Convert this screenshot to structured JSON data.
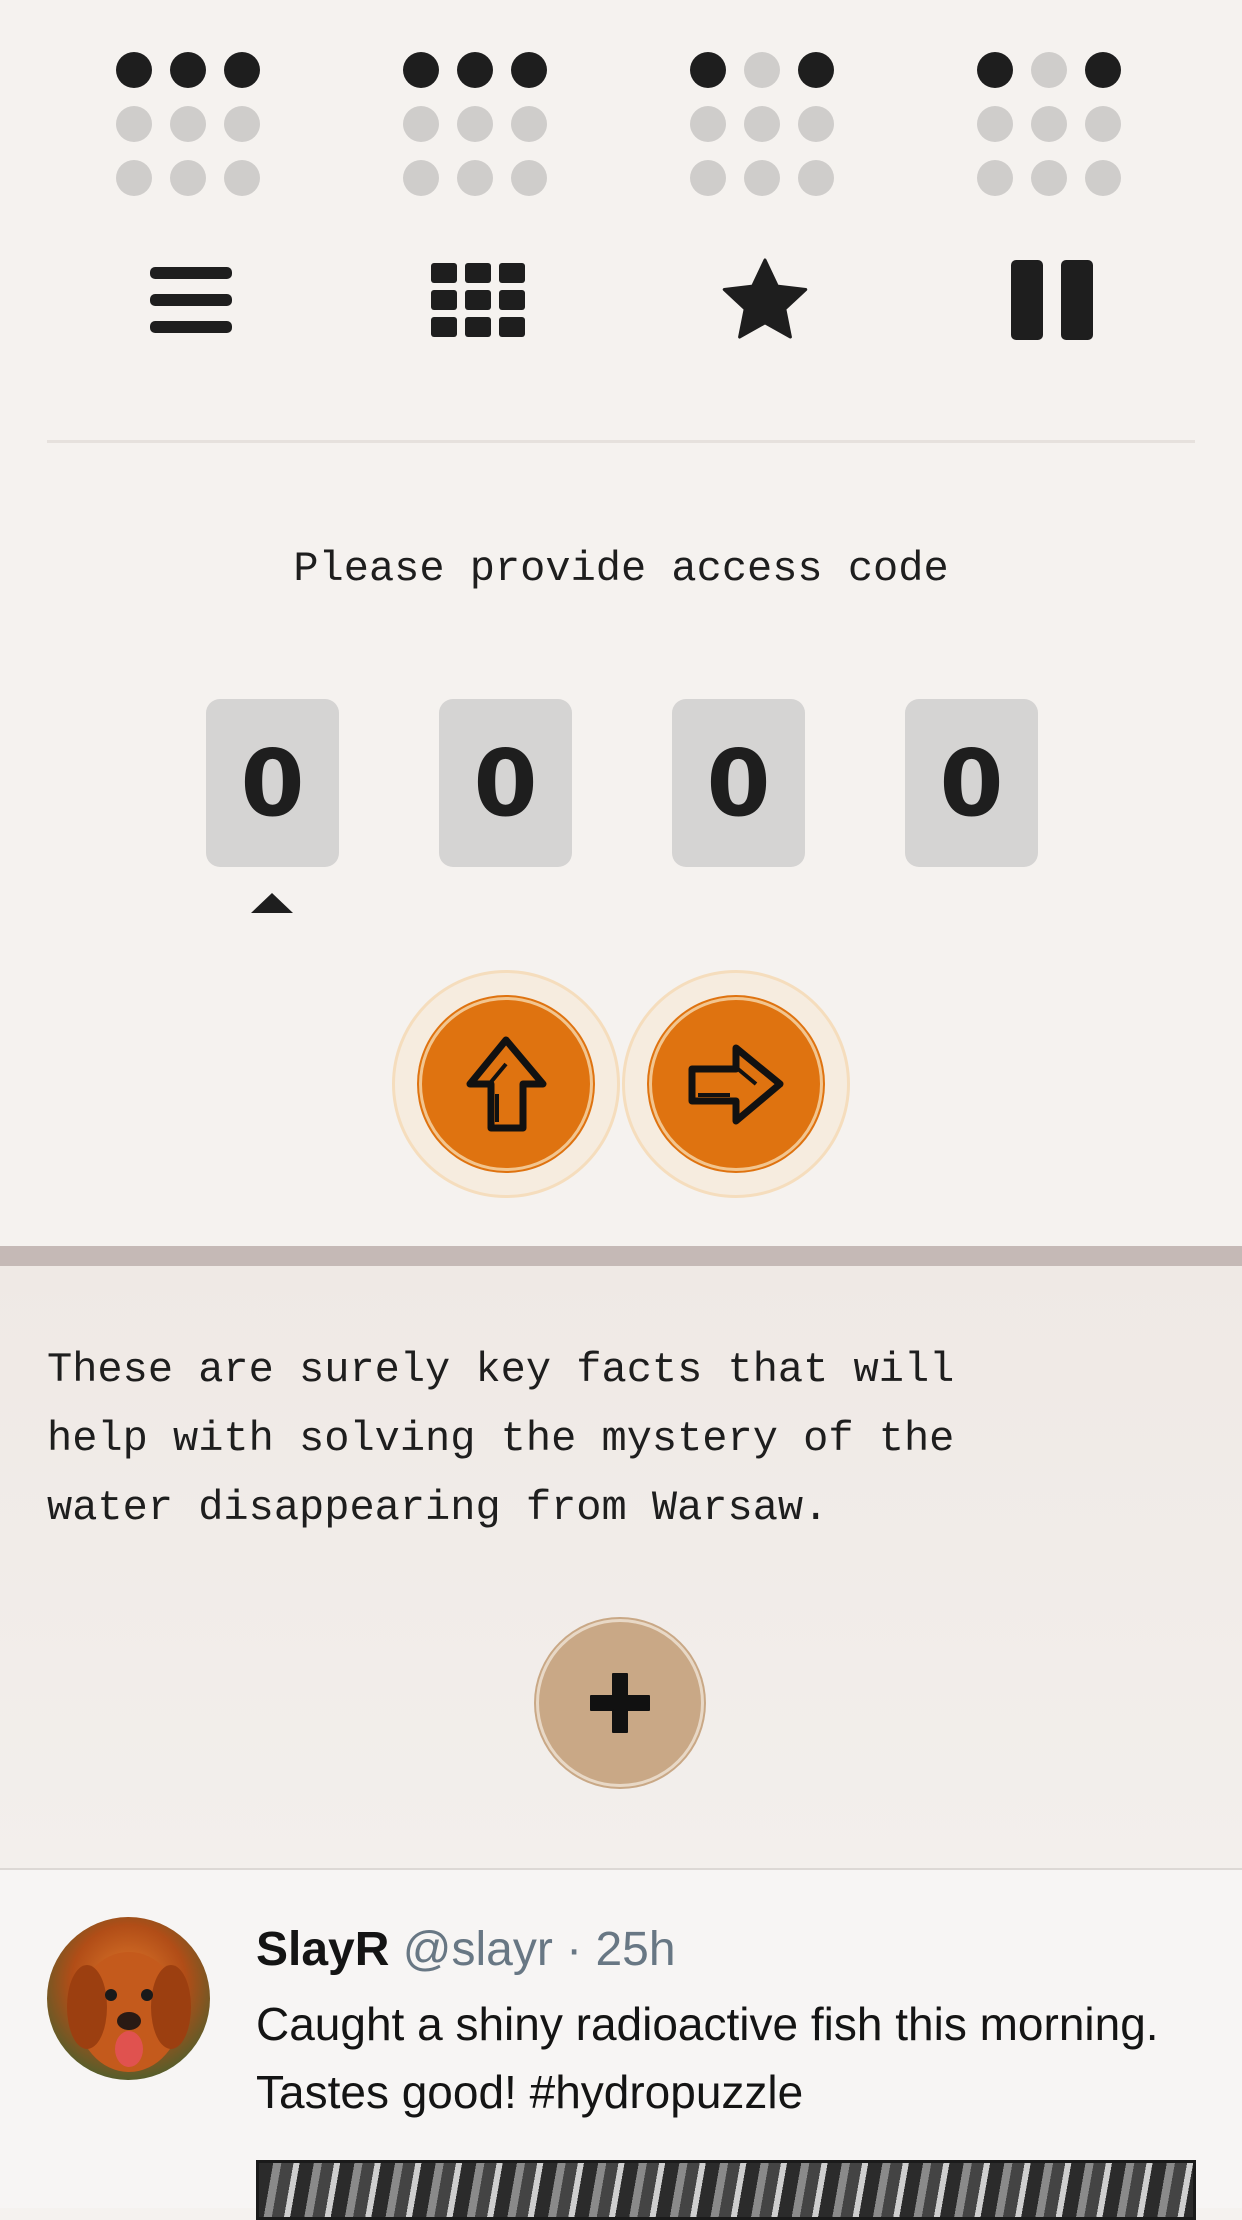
{
  "indicators": [
    {
      "dots": [
        1,
        1,
        1,
        0,
        0,
        0,
        0,
        0,
        0
      ]
    },
    {
      "dots": [
        1,
        1,
        1,
        0,
        0,
        0,
        0,
        0,
        0
      ]
    },
    {
      "dots": [
        1,
        0,
        1,
        0,
        0,
        0,
        0,
        0,
        0
      ]
    },
    {
      "dots": [
        1,
        0,
        1,
        0,
        0,
        0,
        0,
        0,
        0
      ]
    }
  ],
  "toolbar": {
    "icons": [
      "menu-icon",
      "grid-icon",
      "star-icon",
      "pause-icon"
    ]
  },
  "access": {
    "prompt": "Please provide access code",
    "digits": [
      "0",
      "0",
      "0",
      "0"
    ],
    "selected_digit": 1,
    "buttons": [
      "up-arrow-icon",
      "right-arrow-icon"
    ]
  },
  "notes": {
    "text": "These are surely key facts that will\nhelp with solving the mystery of the\nwater disappearing from Warsaw.",
    "add_icon": "plus-icon"
  },
  "post": {
    "name": "SlayR",
    "handle": "@slayr",
    "separator": " · ",
    "time": "25h",
    "body": "Caught a shiny radioactive fish this morning. Tastes good! #hydropuzzle"
  },
  "colors": {
    "accent": "#df7310",
    "add_button": "#c9a886",
    "digit_bg": "#d5d4d3",
    "text": "#1e1e1e"
  }
}
